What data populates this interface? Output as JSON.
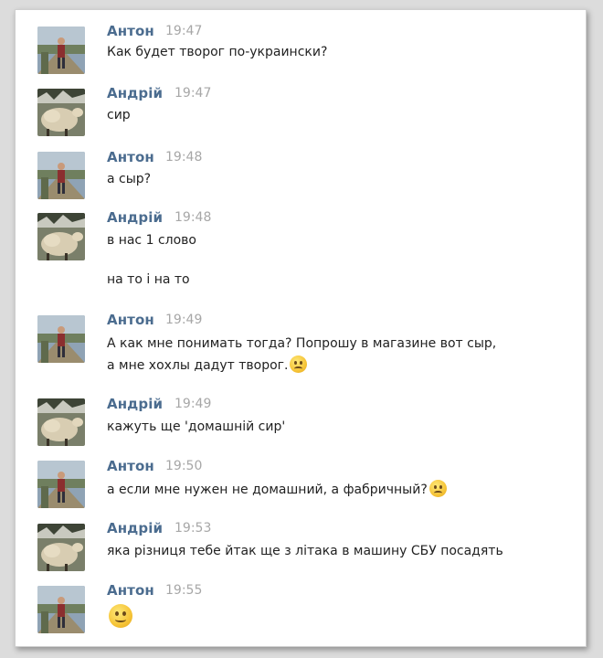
{
  "chat": {
    "messages": [
      {
        "author": "Антон",
        "time": "19:47",
        "text": "Как будет творог по-украински?"
      },
      {
        "author": "Андрій",
        "time": "19:47",
        "text": "сир"
      },
      {
        "author": "Антон",
        "time": "19:48",
        "text": "а сыр?"
      },
      {
        "author": "Андрій",
        "time": "19:48",
        "text": "в нас 1 слово",
        "text2": "на то і на то"
      },
      {
        "author": "Антон",
        "time": "19:49",
        "text": "А как мне понимать тогда? Попрошу в магазине вот сыр,",
        "text_line2": "а мне хохлы дадут творог.",
        "emoji": "thinking-emoji"
      },
      {
        "author": "Андрій",
        "time": "19:49",
        "text": "кажуть ще 'домашній сир'"
      },
      {
        "author": "Антон",
        "time": "19:50",
        "text": "а если мне нужен не домашний, а фабричный?",
        "emoji": "sad-emoji"
      },
      {
        "author": "Андрій",
        "time": "19:53",
        "text": "яка різниця тебе йтак ще з літака в машину СБУ посадять"
      },
      {
        "author": "Антон",
        "time": "19:55",
        "emoji": "smile-emoji"
      }
    ]
  }
}
